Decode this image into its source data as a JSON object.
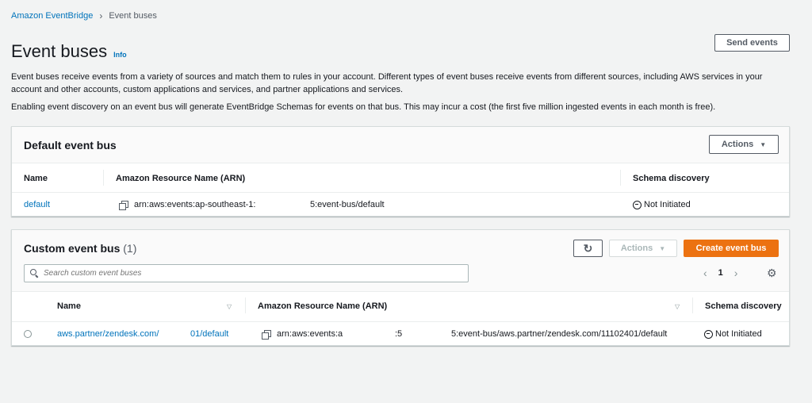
{
  "breadcrumb": {
    "parent": "Amazon EventBridge",
    "current": "Event buses"
  },
  "page": {
    "title": "Event buses",
    "info": "Info",
    "send_events": "Send events",
    "description1": "Event buses receive events from a variety of sources and match them to rules in your account. Different types of event buses receive events from different sources, including AWS services in your account and other accounts, custom applications and services, and partner applications and services.",
    "description2": "Enabling event discovery on an event bus will generate EventBridge Schemas for events on that bus. This may incur a cost (the first five million ingested events in each month is free)."
  },
  "default_bus": {
    "title": "Default event bus",
    "actions": "Actions",
    "columns": {
      "name": "Name",
      "arn": "Amazon Resource Name (ARN)",
      "schema": "Schema discovery"
    },
    "row": {
      "name": "default",
      "arn_start": "arn:aws:events:ap-southeast-1:",
      "arn_end": "5:event-bus/default",
      "schema": "Not Initiated"
    }
  },
  "custom_bus": {
    "title": "Custom event bus",
    "count": "(1)",
    "actions": "Actions",
    "create": "Create event bus",
    "search_placeholder": "Search custom event buses",
    "page": "1",
    "columns": {
      "name": "Name",
      "arn": "Amazon Resource Name (ARN)",
      "schema": "Schema discovery"
    },
    "row": {
      "name_start": "aws.partner/zendesk.com/",
      "name_end": "01/default",
      "arn_start": "arn:aws:events:a",
      "arn_mid": ":5",
      "arn_end": "5:event-bus/aws.partner/zendesk.com/11102401/default",
      "schema": "Not Initiated"
    }
  },
  "colors": {
    "link": "#0073bb",
    "primary": "#ec7211",
    "background": "#f2f3f3"
  }
}
